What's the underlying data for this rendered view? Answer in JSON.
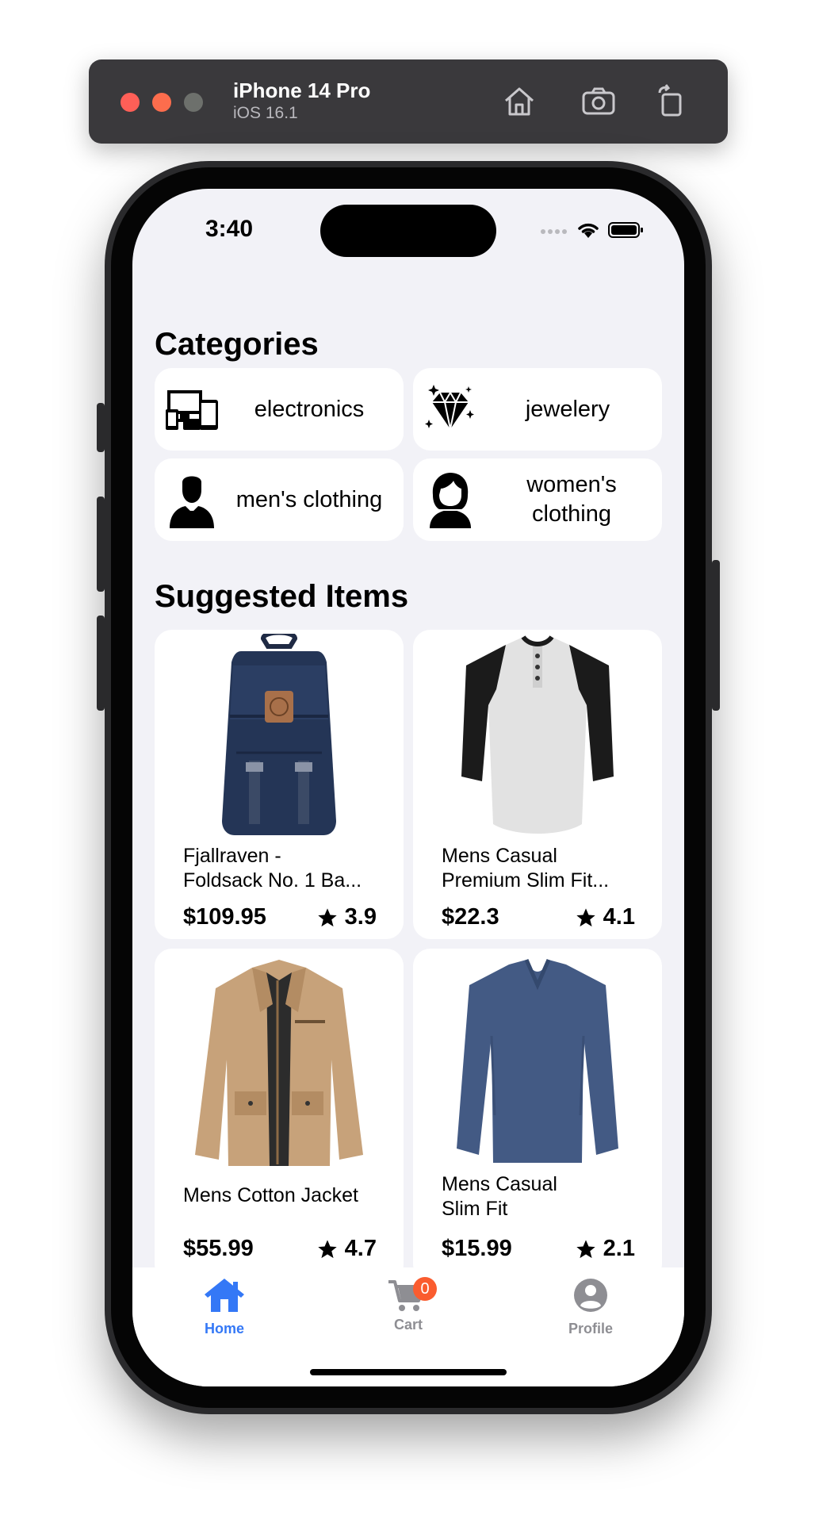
{
  "simulator": {
    "device_name": "iPhone 14 Pro",
    "os_version": "iOS 16.1",
    "buttons": [
      "home-icon",
      "screenshot-icon",
      "rotate-icon"
    ]
  },
  "status_bar": {
    "time": "3:40"
  },
  "categories": {
    "title": "Categories",
    "items": [
      {
        "label": "electronics",
        "icon": "electronics-icon"
      },
      {
        "label": "jewelery",
        "icon": "diamond-icon"
      },
      {
        "label": "men's clothing",
        "icon": "man-icon"
      },
      {
        "label": "women's clothing",
        "icon": "woman-icon"
      }
    ]
  },
  "suggested": {
    "title": "Suggested Items",
    "items": [
      {
        "name_line1": "Fjallraven -",
        "name_line2": "Foldsack No. 1 Ba...",
        "price": "$109.95",
        "rating": "3.9",
        "image": "backpack-image"
      },
      {
        "name_line1": "Mens Casual",
        "name_line2": "Premium Slim Fit...",
        "price": "$22.3",
        "rating": "4.1",
        "image": "henley-shirt-image"
      },
      {
        "name_line1": "Mens Cotton Jacket",
        "name_line2": "",
        "price": "$55.99",
        "rating": "4.7",
        "image": "jacket-image"
      },
      {
        "name_line1": "Mens Casual",
        "name_line2": "Slim Fit",
        "price": "$15.99",
        "rating": "2.1",
        "image": "longsleeve-image"
      }
    ]
  },
  "tabbar": {
    "tabs": [
      {
        "label": "Home",
        "icon": "home-icon",
        "active": true
      },
      {
        "label": "Cart",
        "icon": "cart-icon",
        "badge": "0"
      },
      {
        "label": "Profile",
        "icon": "profile-icon"
      }
    ]
  },
  "colors": {
    "accent": "#3478f6",
    "tab_inactive": "#8e8e93",
    "badge": "#fa5c2f",
    "background": "#f2f2f7"
  }
}
